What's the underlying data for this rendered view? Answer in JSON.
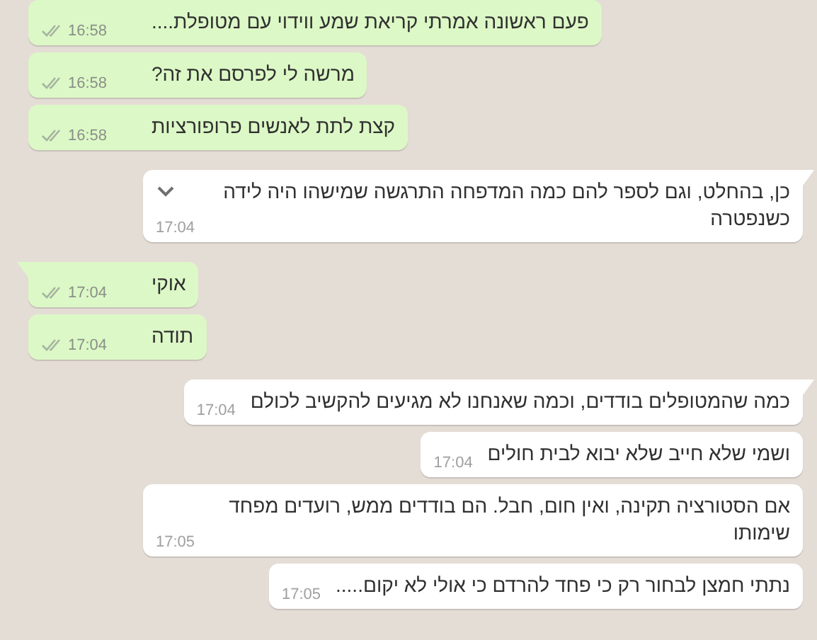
{
  "messages": [
    {
      "outgoing": true,
      "tail": false,
      "text": "פעם ראשונה אמרתי קריאת שמע ווידוי עם מטופלת....",
      "time": "16:58",
      "read": false,
      "hovered": false
    },
    {
      "outgoing": true,
      "tail": false,
      "text": "מרשה לי לפרסם את זה?",
      "time": "16:58",
      "read": false,
      "hovered": false
    },
    {
      "outgoing": true,
      "tail": false,
      "text": "קצת לתת לאנשים פרופורציות",
      "time": "16:58",
      "read": false,
      "hovered": false
    },
    {
      "outgoing": false,
      "tail": true,
      "text": "כן, בהחלט, וגם לספר להם כמה המדפחה התרגשה שמישהו היה לידה כשנפטרה",
      "time": "17:04",
      "hovered": true
    },
    {
      "outgoing": true,
      "tail": true,
      "text": "אוקי",
      "time": "17:04",
      "read": false,
      "hovered": false
    },
    {
      "outgoing": true,
      "tail": false,
      "text": "תודה",
      "time": "17:04",
      "read": false,
      "hovered": false
    },
    {
      "outgoing": false,
      "tail": true,
      "text": "כמה שהמטופלים בודדים, וכמה שאנחנו לא מגיעים להקשיב לכולם",
      "time": "17:04",
      "hovered": false
    },
    {
      "outgoing": false,
      "tail": false,
      "text": "ושמי שלא חייב שלא יבוא לבית חולים",
      "time": "17:04",
      "hovered": false
    },
    {
      "outgoing": false,
      "tail": false,
      "text": "אם הסטורציה תקינה, ואין חום, חבל. הם בודדים ממש, רועדים מפחד שימותו",
      "time": "17:05",
      "hovered": false
    },
    {
      "outgoing": false,
      "tail": false,
      "text": "נתתי חמצן לבחור רק כי פחד להרדם כי אולי לא יקום.....",
      "time": "17:05",
      "hovered": false
    }
  ]
}
